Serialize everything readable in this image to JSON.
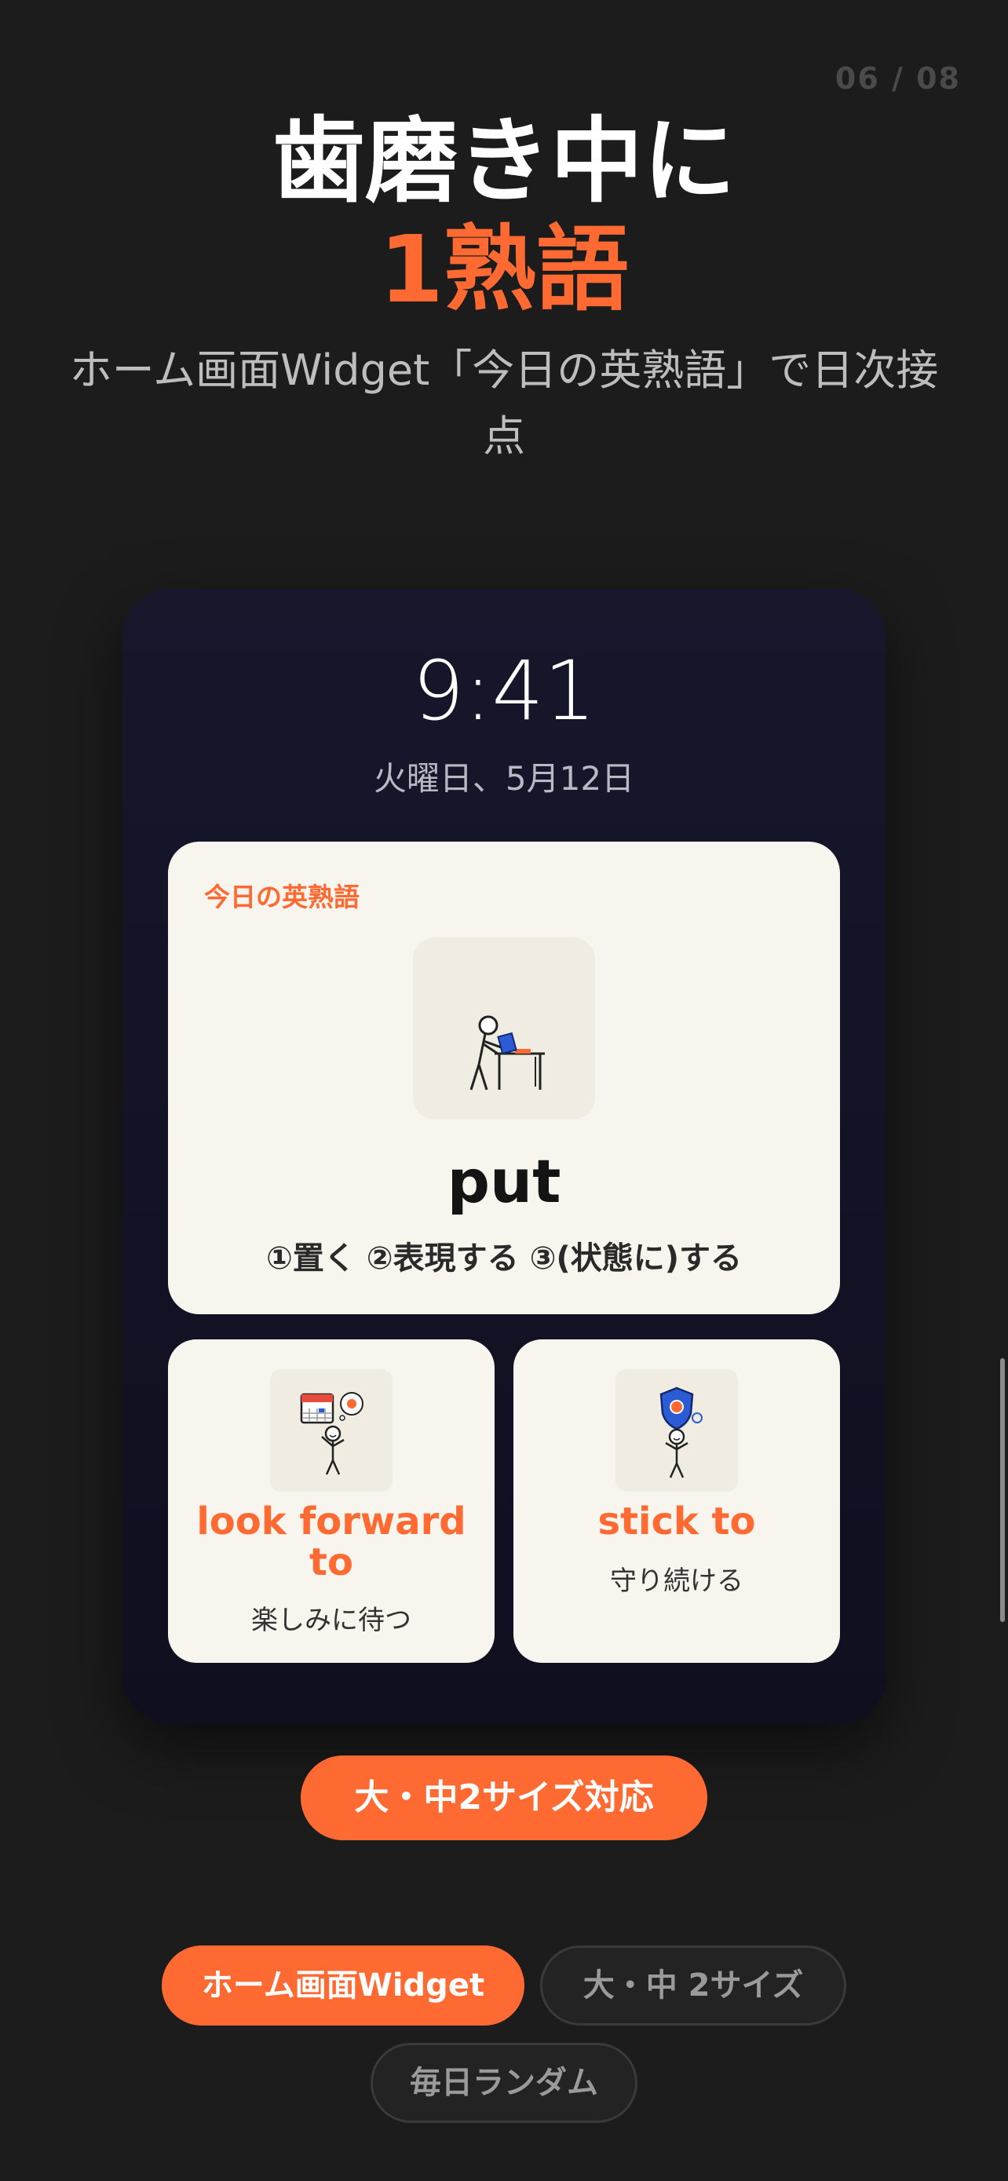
{
  "page_counter": "06 / 08",
  "headline": {
    "line1": "歯磨き中に",
    "line2": "1熟語"
  },
  "subtitle": {
    "line1": "ホーム画面Widget「今日の英熟語」で日次接",
    "line2": "点"
  },
  "lockscreen": {
    "time": "9:41",
    "date": "火曜日、5月12日"
  },
  "widget_large": {
    "label": "今日の英熟語",
    "word": "put",
    "meaning": "①置く ②表現する ③(状態に)する",
    "icon": "person-at-desk-illustration"
  },
  "widget_small": [
    {
      "word_line1": "look forward",
      "word_line2": "to",
      "meaning": "楽しみに待つ",
      "icon": "calendar-person-illustration"
    },
    {
      "word_line1": "stick to",
      "meaning": "守り続ける",
      "icon": "shield-person-illustration"
    }
  ],
  "size_badge": "大・中2サイズ対応",
  "chips": [
    {
      "label": "ホーム画面Widget",
      "active": true
    },
    {
      "label": "大・中 2サイズ",
      "active": false
    },
    {
      "label": "毎日ランダム",
      "active": false
    }
  ],
  "colors": {
    "accent": "#ff6a33",
    "background": "#1c1c1c",
    "widget_bg": "#f8f5ee",
    "phone_bg": "#13132a"
  }
}
